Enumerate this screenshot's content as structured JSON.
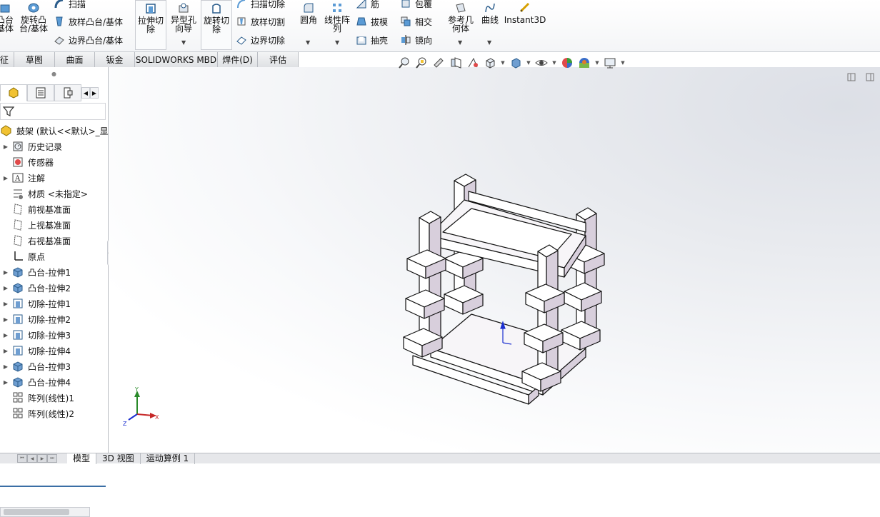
{
  "ribbon": {
    "big_left_1": "凸台\n基体",
    "big_left_2": "旋转凸\n台/基体",
    "sweep": "扫描",
    "loft": "放样凸台/基体",
    "boundary": "边界凸台/基体",
    "extrude_cut": "拉伸切\n除",
    "hole_wizard": "异型孔\n向导",
    "revolve_cut": "旋转切\n除",
    "sweep_cut": "扫描切除",
    "loft_cut": "放样切割",
    "boundary_cut": "边界切除",
    "fillet": "圆角",
    "linear_pattern": "线性阵\n列",
    "rib": "筋",
    "draft": "拔模",
    "shell": "抽壳",
    "wrap": "包覆",
    "intersect": "相交",
    "mirror": "镜向",
    "ref_geometry": "参考几\n何体",
    "curves": "曲线",
    "instant3d": "Instant3D"
  },
  "tabs": [
    "征",
    "草图",
    "曲面",
    "钣金",
    "SOLIDWORKS MBD",
    "焊件(D)",
    "评估"
  ],
  "tree": {
    "root": "鼓架  (默认<<默认>_显",
    "items": [
      {
        "label": "历史记录",
        "icon": "history-icon",
        "expandable": true
      },
      {
        "label": "传感器",
        "icon": "sensor-icon",
        "expandable": false
      },
      {
        "label": "注解",
        "icon": "annotation-icon",
        "expandable": true
      },
      {
        "label": "材质 <未指定>",
        "icon": "material-icon",
        "expandable": false
      },
      {
        "label": "前视基准面",
        "icon": "plane-icon",
        "expandable": false
      },
      {
        "label": "上视基准面",
        "icon": "plane-icon",
        "expandable": false
      },
      {
        "label": "右视基准面",
        "icon": "plane-icon",
        "expandable": false
      },
      {
        "label": "原点",
        "icon": "origin-icon",
        "expandable": false
      },
      {
        "label": "凸台-拉伸1",
        "icon": "boss-extrude-icon",
        "expandable": true
      },
      {
        "label": "凸台-拉伸2",
        "icon": "boss-extrude-icon",
        "expandable": true
      },
      {
        "label": "切除-拉伸1",
        "icon": "cut-extrude-icon",
        "expandable": true
      },
      {
        "label": "切除-拉伸2",
        "icon": "cut-extrude-icon",
        "expandable": true
      },
      {
        "label": "切除-拉伸3",
        "icon": "cut-extrude-icon",
        "expandable": true
      },
      {
        "label": "切除-拉伸4",
        "icon": "cut-extrude-icon",
        "expandable": true
      },
      {
        "label": "凸台-拉伸3",
        "icon": "boss-extrude-icon",
        "expandable": true
      },
      {
        "label": "凸台-拉伸4",
        "icon": "boss-extrude-icon",
        "expandable": true
      },
      {
        "label": "阵列(线性)1",
        "icon": "linear-pattern-icon",
        "expandable": false
      },
      {
        "label": "阵列(线性)2",
        "icon": "linear-pattern-icon",
        "expandable": false
      }
    ]
  },
  "triad": {
    "x": "X",
    "y": "Y",
    "z": "Z"
  },
  "bottom_tabs": [
    "模型",
    "3D 视图",
    "运动算例 1"
  ],
  "colors": {
    "accent": "#3a6ea5",
    "part_face": "#ffffff",
    "part_shade": "#d8cfdc",
    "part_edge": "#111111"
  }
}
